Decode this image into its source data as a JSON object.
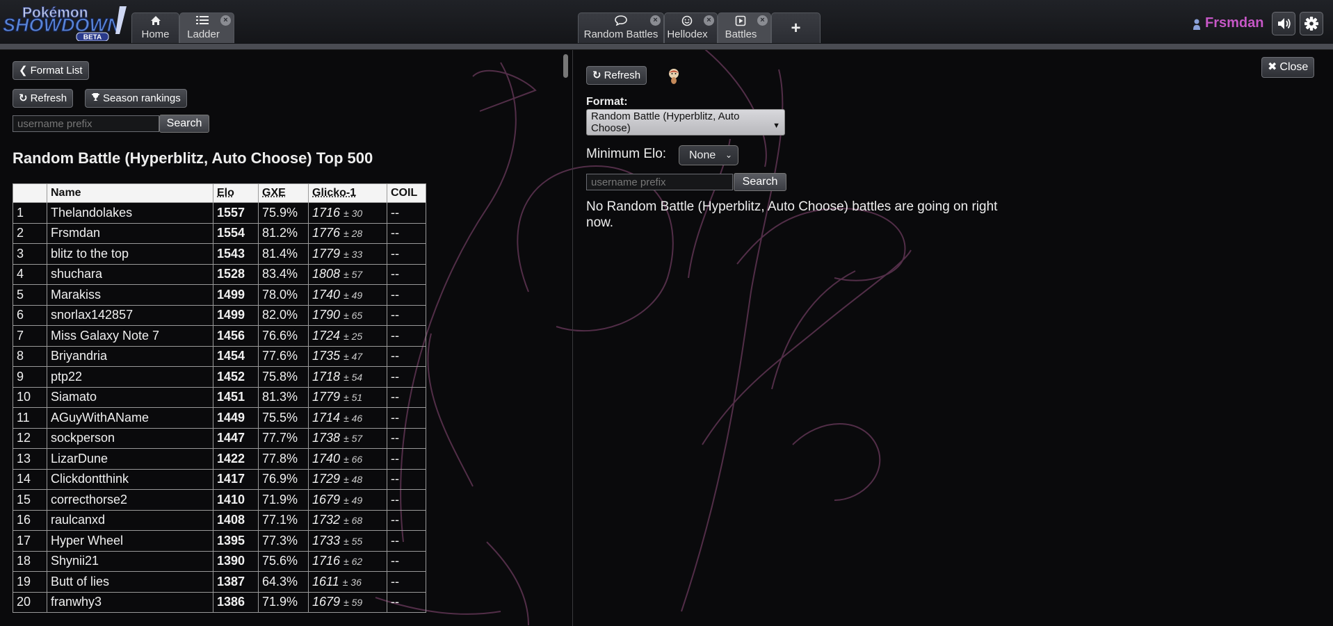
{
  "logo": {
    "line1": "Pokémon",
    "line2": "SHOWDOWN",
    "badge": "BETA"
  },
  "tabs_left": [
    {
      "label": "Home",
      "icon": "home-icon",
      "closable": false,
      "active": false
    },
    {
      "label": "Ladder",
      "icon": "list-icon",
      "closable": true,
      "active": true
    }
  ],
  "tabs_right": [
    {
      "label": "Random Battles",
      "icon": "chat-bubble-icon",
      "closable": true,
      "active": false
    },
    {
      "label": "Hellodex",
      "icon": "smiley-icon",
      "closable": true,
      "active": false
    },
    {
      "label": "Battles",
      "icon": "play-icon",
      "closable": true,
      "active": true
    }
  ],
  "user": {
    "name": "Frsmdan",
    "color": "#c657c6"
  },
  "left": {
    "format_list_label": "Format List",
    "refresh_label": "Refresh",
    "season_label": "Season rankings",
    "search_placeholder": "username prefix",
    "search_label": "Search",
    "title": "Random Battle (Hyperblitz, Auto Choose) Top 500",
    "columns": [
      "",
      "Name",
      "Elo",
      "GXE",
      "Glicko-1",
      "COIL"
    ],
    "rows": [
      {
        "rank": "1",
        "name": "Thelandolakes",
        "elo": "1557",
        "gxe": "75.9%",
        "glicko": "1716",
        "dev": "± 30",
        "coil": "--"
      },
      {
        "rank": "2",
        "name": "Frsmdan",
        "elo": "1554",
        "gxe": "81.2%",
        "glicko": "1776",
        "dev": "± 28",
        "coil": "--"
      },
      {
        "rank": "3",
        "name": "blitz to the top",
        "elo": "1543",
        "gxe": "81.4%",
        "glicko": "1779",
        "dev": "± 33",
        "coil": "--"
      },
      {
        "rank": "4",
        "name": "shuchara",
        "elo": "1528",
        "gxe": "83.4%",
        "glicko": "1808",
        "dev": "± 57",
        "coil": "--"
      },
      {
        "rank": "5",
        "name": "Marakiss",
        "elo": "1499",
        "gxe": "78.0%",
        "glicko": "1740",
        "dev": "± 49",
        "coil": "--"
      },
      {
        "rank": "6",
        "name": "snorlax142857",
        "elo": "1499",
        "gxe": "82.0%",
        "glicko": "1790",
        "dev": "± 65",
        "coil": "--"
      },
      {
        "rank": "7",
        "name": "Miss Galaxy Note 7",
        "elo": "1456",
        "gxe": "76.6%",
        "glicko": "1724",
        "dev": "± 25",
        "coil": "--"
      },
      {
        "rank": "8",
        "name": "Briyandria",
        "elo": "1454",
        "gxe": "77.6%",
        "glicko": "1735",
        "dev": "± 47",
        "coil": "--"
      },
      {
        "rank": "9",
        "name": "ptp22",
        "elo": "1452",
        "gxe": "75.8%",
        "glicko": "1718",
        "dev": "± 54",
        "coil": "--"
      },
      {
        "rank": "10",
        "name": "Siamato",
        "elo": "1451",
        "gxe": "81.3%",
        "glicko": "1779",
        "dev": "± 51",
        "coil": "--"
      },
      {
        "rank": "11",
        "name": "AGuyWithAName",
        "elo": "1449",
        "gxe": "75.5%",
        "glicko": "1714",
        "dev": "± 46",
        "coil": "--"
      },
      {
        "rank": "12",
        "name": "sockperson",
        "elo": "1447",
        "gxe": "77.7%",
        "glicko": "1738",
        "dev": "± 57",
        "coil": "--"
      },
      {
        "rank": "13",
        "name": "LizarDune",
        "elo": "1422",
        "gxe": "77.8%",
        "glicko": "1740",
        "dev": "± 66",
        "coil": "--"
      },
      {
        "rank": "14",
        "name": "Clickdontthink",
        "elo": "1417",
        "gxe": "76.9%",
        "glicko": "1729",
        "dev": "± 48",
        "coil": "--"
      },
      {
        "rank": "15",
        "name": "correcthorse2",
        "elo": "1410",
        "gxe": "71.9%",
        "glicko": "1679",
        "dev": "± 49",
        "coil": "--"
      },
      {
        "rank": "16",
        "name": "raulcanxd",
        "elo": "1408",
        "gxe": "77.1%",
        "glicko": "1732",
        "dev": "± 68",
        "coil": "--"
      },
      {
        "rank": "17",
        "name": "Hyper Wheel",
        "elo": "1395",
        "gxe": "77.3%",
        "glicko": "1733",
        "dev": "± 55",
        "coil": "--"
      },
      {
        "rank": "18",
        "name": "Shynii21",
        "elo": "1390",
        "gxe": "75.6%",
        "glicko": "1716",
        "dev": "± 62",
        "coil": "--"
      },
      {
        "rank": "19",
        "name": "Butt of lies",
        "elo": "1387",
        "gxe": "64.3%",
        "glicko": "1611",
        "dev": "± 36",
        "coil": "--"
      },
      {
        "rank": "20",
        "name": "franwhy3",
        "elo": "1386",
        "gxe": "71.9%",
        "glicko": "1679",
        "dev": "± 59",
        "coil": "--"
      }
    ]
  },
  "right": {
    "refresh_label": "Refresh",
    "format_label": "Format:",
    "format_value": "Random Battle (Hyperblitz, Auto Choose)",
    "min_elo_label": "Minimum Elo:",
    "min_elo_value": "None",
    "search_placeholder": "username prefix",
    "search_label": "Search",
    "message": "No Random Battle (Hyperblitz, Auto Choose) battles are going on right now.",
    "close_label": "Close"
  }
}
